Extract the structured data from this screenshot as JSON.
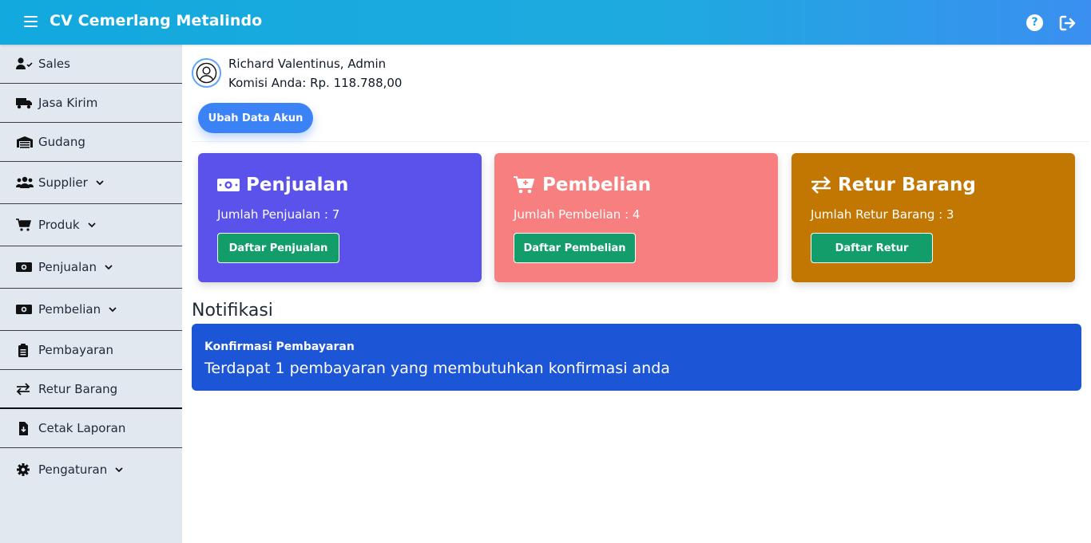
{
  "app": {
    "title": "CV Cemerlang Metalindo"
  },
  "topbar": {
    "help_icon": "question-circle-icon",
    "logout_icon": "sign-out-icon",
    "help_glyph": "?"
  },
  "sidebar": {
    "items": [
      {
        "label": "Sales",
        "icon": "user-check-icon",
        "dropdown": false
      },
      {
        "label": "Jasa Kirim",
        "icon": "truck-icon",
        "dropdown": false
      },
      {
        "label": "Gudang",
        "icon": "warehouse-icon",
        "dropdown": false
      },
      {
        "label": "Supplier",
        "icon": "users-icon",
        "dropdown": true
      },
      {
        "label": "Produk",
        "icon": "cart-plus-icon",
        "dropdown": true
      },
      {
        "label": "Penjualan",
        "icon": "money-bill-icon",
        "dropdown": true
      },
      {
        "label": "Pembelian",
        "icon": "money-bill-icon",
        "dropdown": true
      },
      {
        "label": "Pembayaran",
        "icon": "clipboard-list-icon",
        "dropdown": false
      },
      {
        "label": "Retur Barang",
        "icon": "exchange-icon",
        "dropdown": false
      },
      {
        "label": "Cetak Laporan",
        "icon": "file-download-icon",
        "dropdown": false
      },
      {
        "label": "Pengaturan",
        "icon": "cog-icon",
        "dropdown": true
      }
    ]
  },
  "profile": {
    "name": "Richard Valentinus, Admin",
    "commission": "Komisi Anda: Rp. 118.788,00",
    "button": "Ubah Data Akun"
  },
  "cards": [
    {
      "title": "Penjualan",
      "count": "Jumlah Penjualan : 7",
      "button": "Daftar Penjualan",
      "color": "#5a52ea",
      "icon": "money-bill-icon"
    },
    {
      "title": "Pembelian",
      "count": "Jumlah Pembelian : 4",
      "button": "Daftar Pembelian",
      "color": "#f87f7f",
      "icon": "cart-plus-icon"
    },
    {
      "title": "Retur Barang",
      "count": "Jumlah Retur Barang : 3",
      "button": "Daftar Retur",
      "color": "#c17702",
      "icon": "exchange-icon"
    }
  ],
  "notifications": {
    "heading": "Notifikasi",
    "items": [
      {
        "title": "Konfirmasi Pembayaran",
        "text": "Terdapat 1 pembayaran yang membutuhkan konfirmasi anda"
      }
    ]
  },
  "colors": {
    "topbar_start": "#12a9de",
    "topbar_end": "#3a8ff0",
    "sidebar_bg": "#e2e8f0",
    "button_green": "#129d6a",
    "notif_blue": "#1c56d6",
    "account_button": "#3b82f6"
  }
}
